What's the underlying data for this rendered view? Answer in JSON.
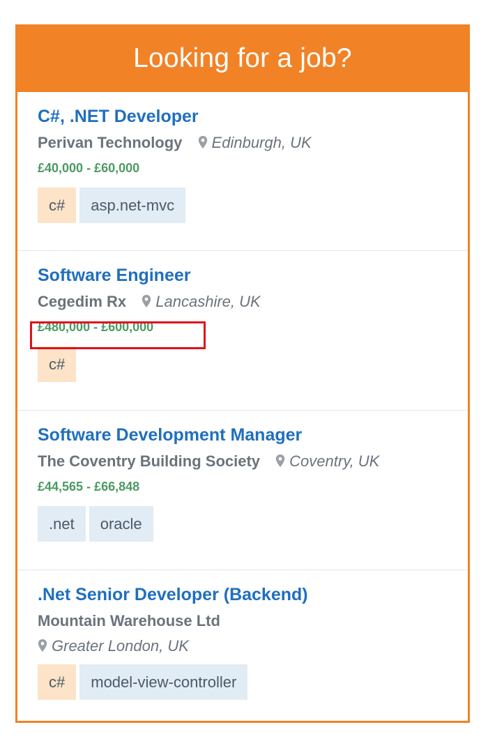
{
  "widget": {
    "title": "Looking for a job?",
    "jobs": [
      {
        "title": "C#, .NET Developer",
        "company": "Perivan Technology",
        "location": "Edinburgh, UK",
        "salary": "£40,000 - £60,000",
        "tags": [
          {
            "label": "c#",
            "style": "orange"
          },
          {
            "label": "asp.net-mvc",
            "style": "blue"
          }
        ]
      },
      {
        "title": "Software Engineer",
        "company": "Cegedim Rx",
        "location": "Lancashire, UK",
        "salary": "£480,000 - £600,000",
        "tags": [
          {
            "label": "c#",
            "style": "orange"
          }
        ]
      },
      {
        "title": "Software Development Manager",
        "company": "The Coventry Building Society",
        "location": "Coventry, UK",
        "salary": "£44,565 - £66,848",
        "tags": [
          {
            "label": ".net",
            "style": "blue"
          },
          {
            "label": "oracle",
            "style": "blue"
          }
        ]
      },
      {
        "title": ".Net Senior Developer (Backend)",
        "company": "Mountain Warehouse Ltd",
        "location": "Greater London, UK",
        "tags": [
          {
            "label": "c#",
            "style": "orange"
          },
          {
            "label": "model-view-controller",
            "style": "blue"
          }
        ]
      }
    ]
  },
  "colors": {
    "accent": "#f28226",
    "link": "#1f6fbf",
    "salary": "#4c9a62",
    "highlight": "#e0101e",
    "tag_orange": "#fde3c7",
    "tag_blue": "#e1ecf4"
  },
  "icons": {
    "location": "map-pin-icon"
  }
}
